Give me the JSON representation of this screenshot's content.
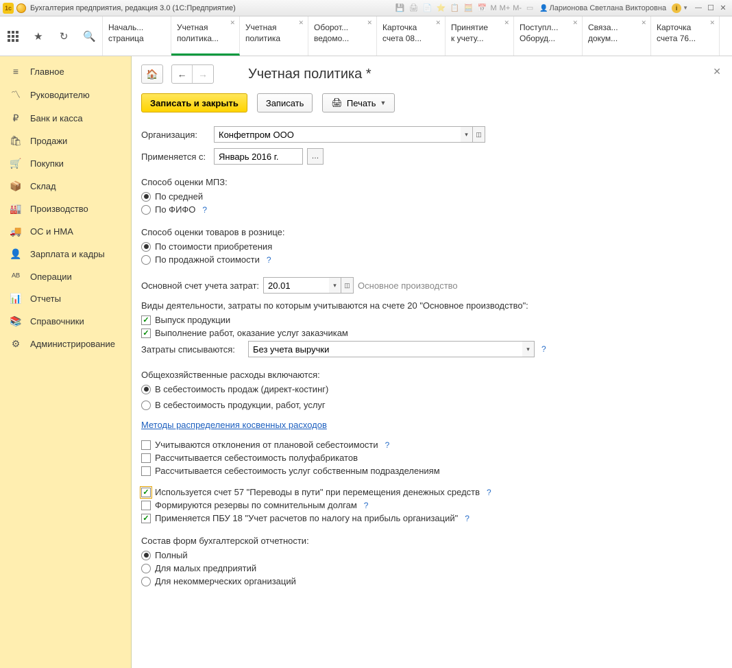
{
  "titlebar": {
    "title": "Бухгалтерия предприятия, редакция 3.0  (1С:Предприятие)",
    "user": "Ларионова Светлана Викторовна",
    "m1": "M",
    "m2": "M+",
    "m3": "M-"
  },
  "tabs": [
    {
      "l1": "Началь...",
      "l2": "страница",
      "close": false
    },
    {
      "l1": "Учетная",
      "l2": "политика...",
      "close": true,
      "active": true
    },
    {
      "l1": "Учетная",
      "l2": "политика",
      "close": true
    },
    {
      "l1": "Оборот...",
      "l2": "ведомо...",
      "close": true
    },
    {
      "l1": "Карточка",
      "l2": "счета 08...",
      "close": true
    },
    {
      "l1": "Принятие",
      "l2": "к учету...",
      "close": true
    },
    {
      "l1": "Поступл...",
      "l2": "Оборуд...",
      "close": true
    },
    {
      "l1": "Связа...",
      "l2": "докум...",
      "close": true
    },
    {
      "l1": "Карточка",
      "l2": "счета 76...",
      "close": true
    }
  ],
  "sidebar": {
    "items": [
      {
        "icon": "≡",
        "label": "Главное"
      },
      {
        "icon": "〽",
        "label": "Руководителю"
      },
      {
        "icon": "₽",
        "label": "Банк и касса"
      },
      {
        "icon": "🛍",
        "label": "Продажи"
      },
      {
        "icon": "🛒",
        "label": "Покупки"
      },
      {
        "icon": "📦",
        "label": "Склад"
      },
      {
        "icon": "🏭",
        "label": "Производство"
      },
      {
        "icon": "🚚",
        "label": "ОС и НМА"
      },
      {
        "icon": "👤",
        "label": "Зарплата и кадры"
      },
      {
        "icon": "ᴬᴮ",
        "label": "Операции"
      },
      {
        "icon": "📊",
        "label": "Отчеты"
      },
      {
        "icon": "📚",
        "label": "Справочники"
      },
      {
        "icon": "⚙",
        "label": "Администрирование"
      }
    ]
  },
  "page": {
    "title": "Учетная политика *",
    "buttons": {
      "save_close": "Записать и закрыть",
      "save": "Записать",
      "print": "Печать"
    },
    "org_label": "Организация:",
    "org_value": "Конфетпром ООО",
    "date_label": "Применяется с:",
    "date_value": "Январь 2016 г.",
    "mpz_label": "Способ оценки МПЗ:",
    "mpz_opt1": "По средней",
    "mpz_opt2": "По ФИФО",
    "retail_label": "Способ оценки товаров в рознице:",
    "retail_opt1": "По стоимости приобретения",
    "retail_opt2": "По продажной стоимости",
    "account_label": "Основной счет учета затрат:",
    "account_value": "20.01",
    "account_hint": "Основное производство",
    "activities_label": "Виды деятельности, затраты по которым учитываются на счете 20 \"Основное производство\":",
    "act_chk1": "Выпуск продукции",
    "act_chk2": "Выполнение работ, оказание услуг заказчикам",
    "writeoff_label": "Затраты списываются:",
    "writeoff_value": "Без учета выручки",
    "overhead_label": "Общехозяйственные расходы включаются:",
    "overhead_opt1": "В себестоимость продаж (директ-костинг)",
    "overhead_opt2": "В  себестоимость продукции, работ, услуг",
    "methods_link": "Методы распределения косвенных расходов",
    "chk_deviations": "Учитываются отклонения от плановой себестоимости",
    "chk_semifinished": "Рассчитывается себестоимость полуфабрикатов",
    "chk_ownservices": "Рассчитывается себестоимость услуг собственным подразделениям",
    "chk_account57": "Используется счет 57 \"Переводы в пути\" при перемещения денежных средств",
    "chk_reserves": "Формируются резервы по сомнительным долгам",
    "chk_pbu18": "Применяется ПБУ 18 \"Учет расчетов по налогу на прибыль организаций\"",
    "reports_label": "Состав форм бухгалтерской отчетности:",
    "rep_opt1": "Полный",
    "rep_opt2": "Для малых предприятий",
    "rep_opt3": "Для некоммерческих организаций"
  }
}
